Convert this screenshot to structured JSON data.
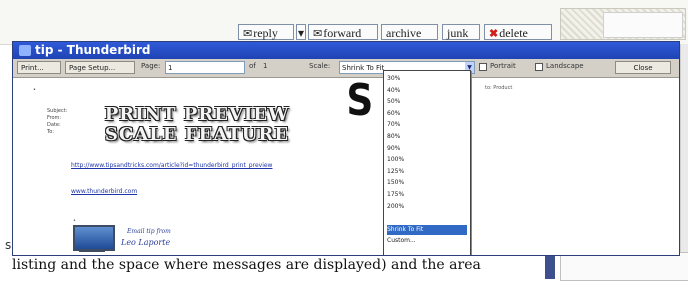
{
  "background": {
    "toolbar": {
      "reply": "reply",
      "forward": "forward",
      "archive": "archive",
      "junk": "junk",
      "delete": "delete"
    },
    "caption": "listing and the space where messages are displayed) and the area",
    "edge_mark": "s"
  },
  "window": {
    "title": "tip - Thunderbird",
    "toolbar": {
      "print": "Print...",
      "page_setup": "Page Setup...",
      "page_label": "Page:",
      "page_value": "1",
      "of_label": "of",
      "of_value": "1",
      "scale_label": "Scale:",
      "scale_value": "Shrink To Fit",
      "portrait_label": "Portrait",
      "landscape_label": "Landscape",
      "close": "Close"
    },
    "scale_options": [
      "30%",
      "40%",
      "50%",
      "60%",
      "70%",
      "80%",
      "90%",
      "100%",
      "125%",
      "150%",
      "175%",
      "200%",
      "",
      "Shrink To Fit",
      "Custom..."
    ],
    "scale_selected": "Shrink To Fit",
    "preview": {
      "title_line1": "PRINT PREVIEW",
      "title_line2": "SCALE FEATURE",
      "subject_label": "Subject:",
      "from_label": "From:",
      "date_label": "Date:",
      "to_label": "To:",
      "url_text": "http://www.tipsandtricks.com/article?id=thunderbird_print_preview",
      "link_text": "www.thunderbird.com",
      "misc": "to: Product",
      "signature_line1": "Email tip from",
      "signature_line2": "Leo Laporte"
    }
  },
  "colors": {
    "titlebar": "#2457d1",
    "link": "#2036a8",
    "selection": "#316ac5"
  }
}
